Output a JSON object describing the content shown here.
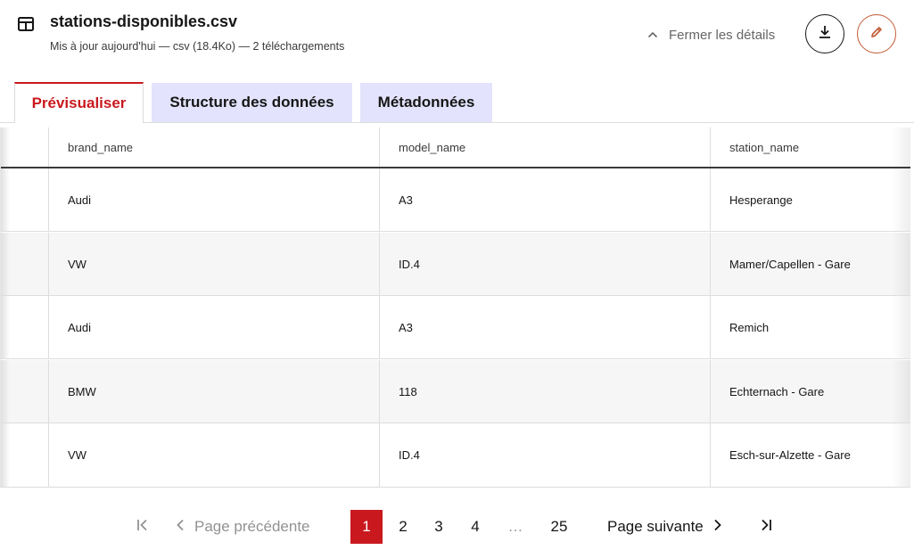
{
  "header": {
    "icon": "table-icon",
    "title": "stations-disponibles.csv",
    "meta": "Mis à jour aujourd'hui — csv (18.4Ko) — 2 téléchargements",
    "toggle_label": "Fermer les détails",
    "download_icon": "download-icon",
    "edit_icon": "pencil-icon"
  },
  "colors": {
    "accent_red": "#c9191e",
    "tab_inactive_bg": "#e3e3fd",
    "edit_border": "#c25b35"
  },
  "tabs": [
    {
      "label": "Prévisualiser",
      "active": true
    },
    {
      "label": "Structure des données",
      "active": false
    },
    {
      "label": "Métadonnées",
      "active": false
    }
  ],
  "table": {
    "columns": [
      "brand_name",
      "model_name",
      "station_name"
    ],
    "rows": [
      [
        "Audi",
        "A3",
        "Hesperange"
      ],
      [
        "VW",
        "ID.4",
        "Mamer/Capellen - Gare"
      ],
      [
        "Audi",
        "A3",
        "Remich"
      ],
      [
        "BMW",
        "118",
        "Echternach - Gare"
      ],
      [
        "VW",
        "ID.4",
        "Esch-sur-Alzette - Gare"
      ]
    ]
  },
  "pagination": {
    "prev_label": "Page précédente",
    "next_label": "Page suivante",
    "pages": [
      "1",
      "2",
      "3",
      "4"
    ],
    "ellipsis": "…",
    "last_page": "25",
    "current": "1"
  }
}
